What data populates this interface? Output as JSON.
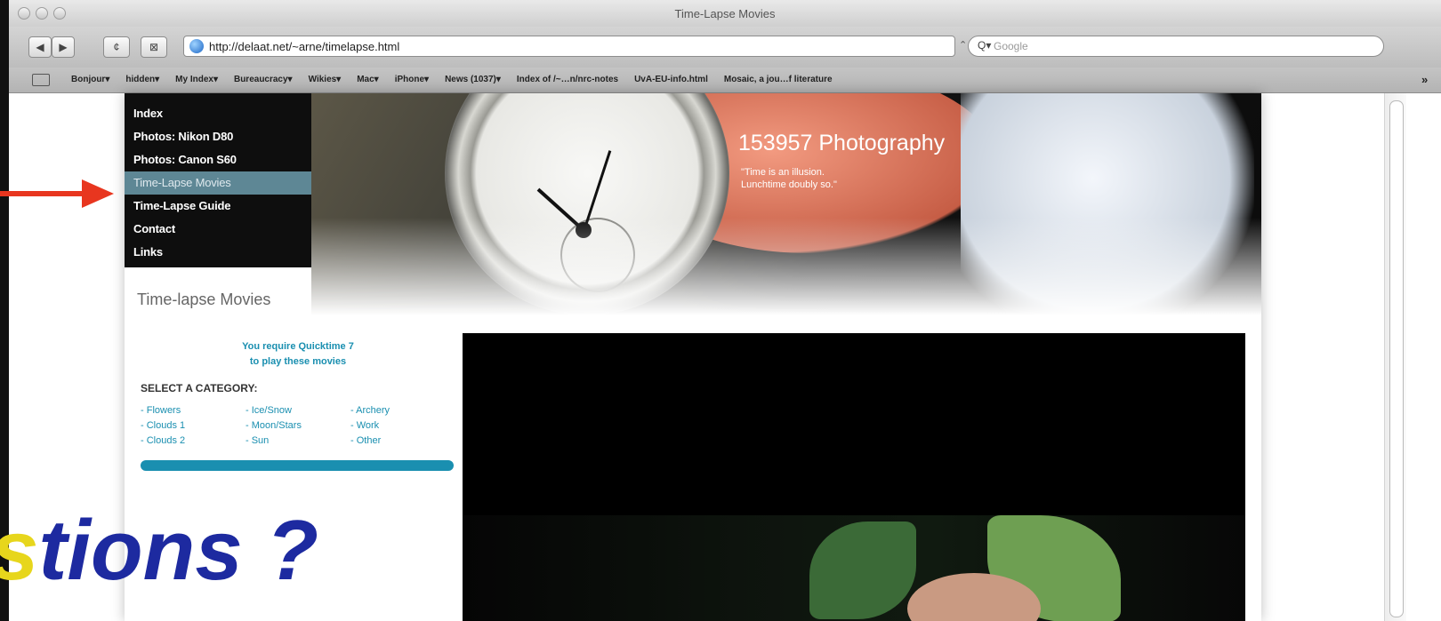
{
  "window": {
    "title": "Time-Lapse Movies"
  },
  "toolbar": {
    "back_label": "◀",
    "forward_label": "▶",
    "reload_label": "¢",
    "snap_label": "⊠",
    "url": "http://delaat.net/~arne/timelapse.html",
    "search_placeholder": "Google"
  },
  "bookmarks": {
    "items": [
      "Bonjour▾",
      "hidden▾",
      "My Index▾",
      "Bureaucracy▾",
      "Wikies▾",
      "Mac▾",
      "iPhone▾",
      "News (1037)▾",
      "Index of /~…n/nrc-notes",
      "UvA-EU-info.html",
      "Mosaic, a jou…f literature"
    ],
    "more": "»"
  },
  "site": {
    "title": "153957 Photography",
    "quote": "\"Time is an illusion. Lunchtime doubly so.\"",
    "nav": [
      "Index",
      "Photos: Nikon D80",
      "Photos: Canon S60",
      "Time-Lapse Movies",
      "Time-Lapse Guide",
      "Contact",
      "Links"
    ],
    "section_title": "Time-lapse Movies",
    "qt_line1": "You require Quicktime 7",
    "qt_line2": "to play these movies",
    "select_label": "SELECT A CATEGORY:",
    "categories": [
      "- Flowers",
      "- Ice/Snow",
      "- Archery",
      "- Clouds 1",
      "- Moon/Stars",
      "- Work",
      "- Clouds 2",
      "- Sun",
      "- Other"
    ]
  },
  "overlay": {
    "text_yellow": "s",
    "text_blue": "tions ?"
  },
  "colors": {
    "accent": "#1a8fb0",
    "nav_active": "#5e8795",
    "overlay_blue": "#1d2aa0",
    "overlay_yellow": "#e7d61c",
    "arrow": "#e8361f"
  }
}
